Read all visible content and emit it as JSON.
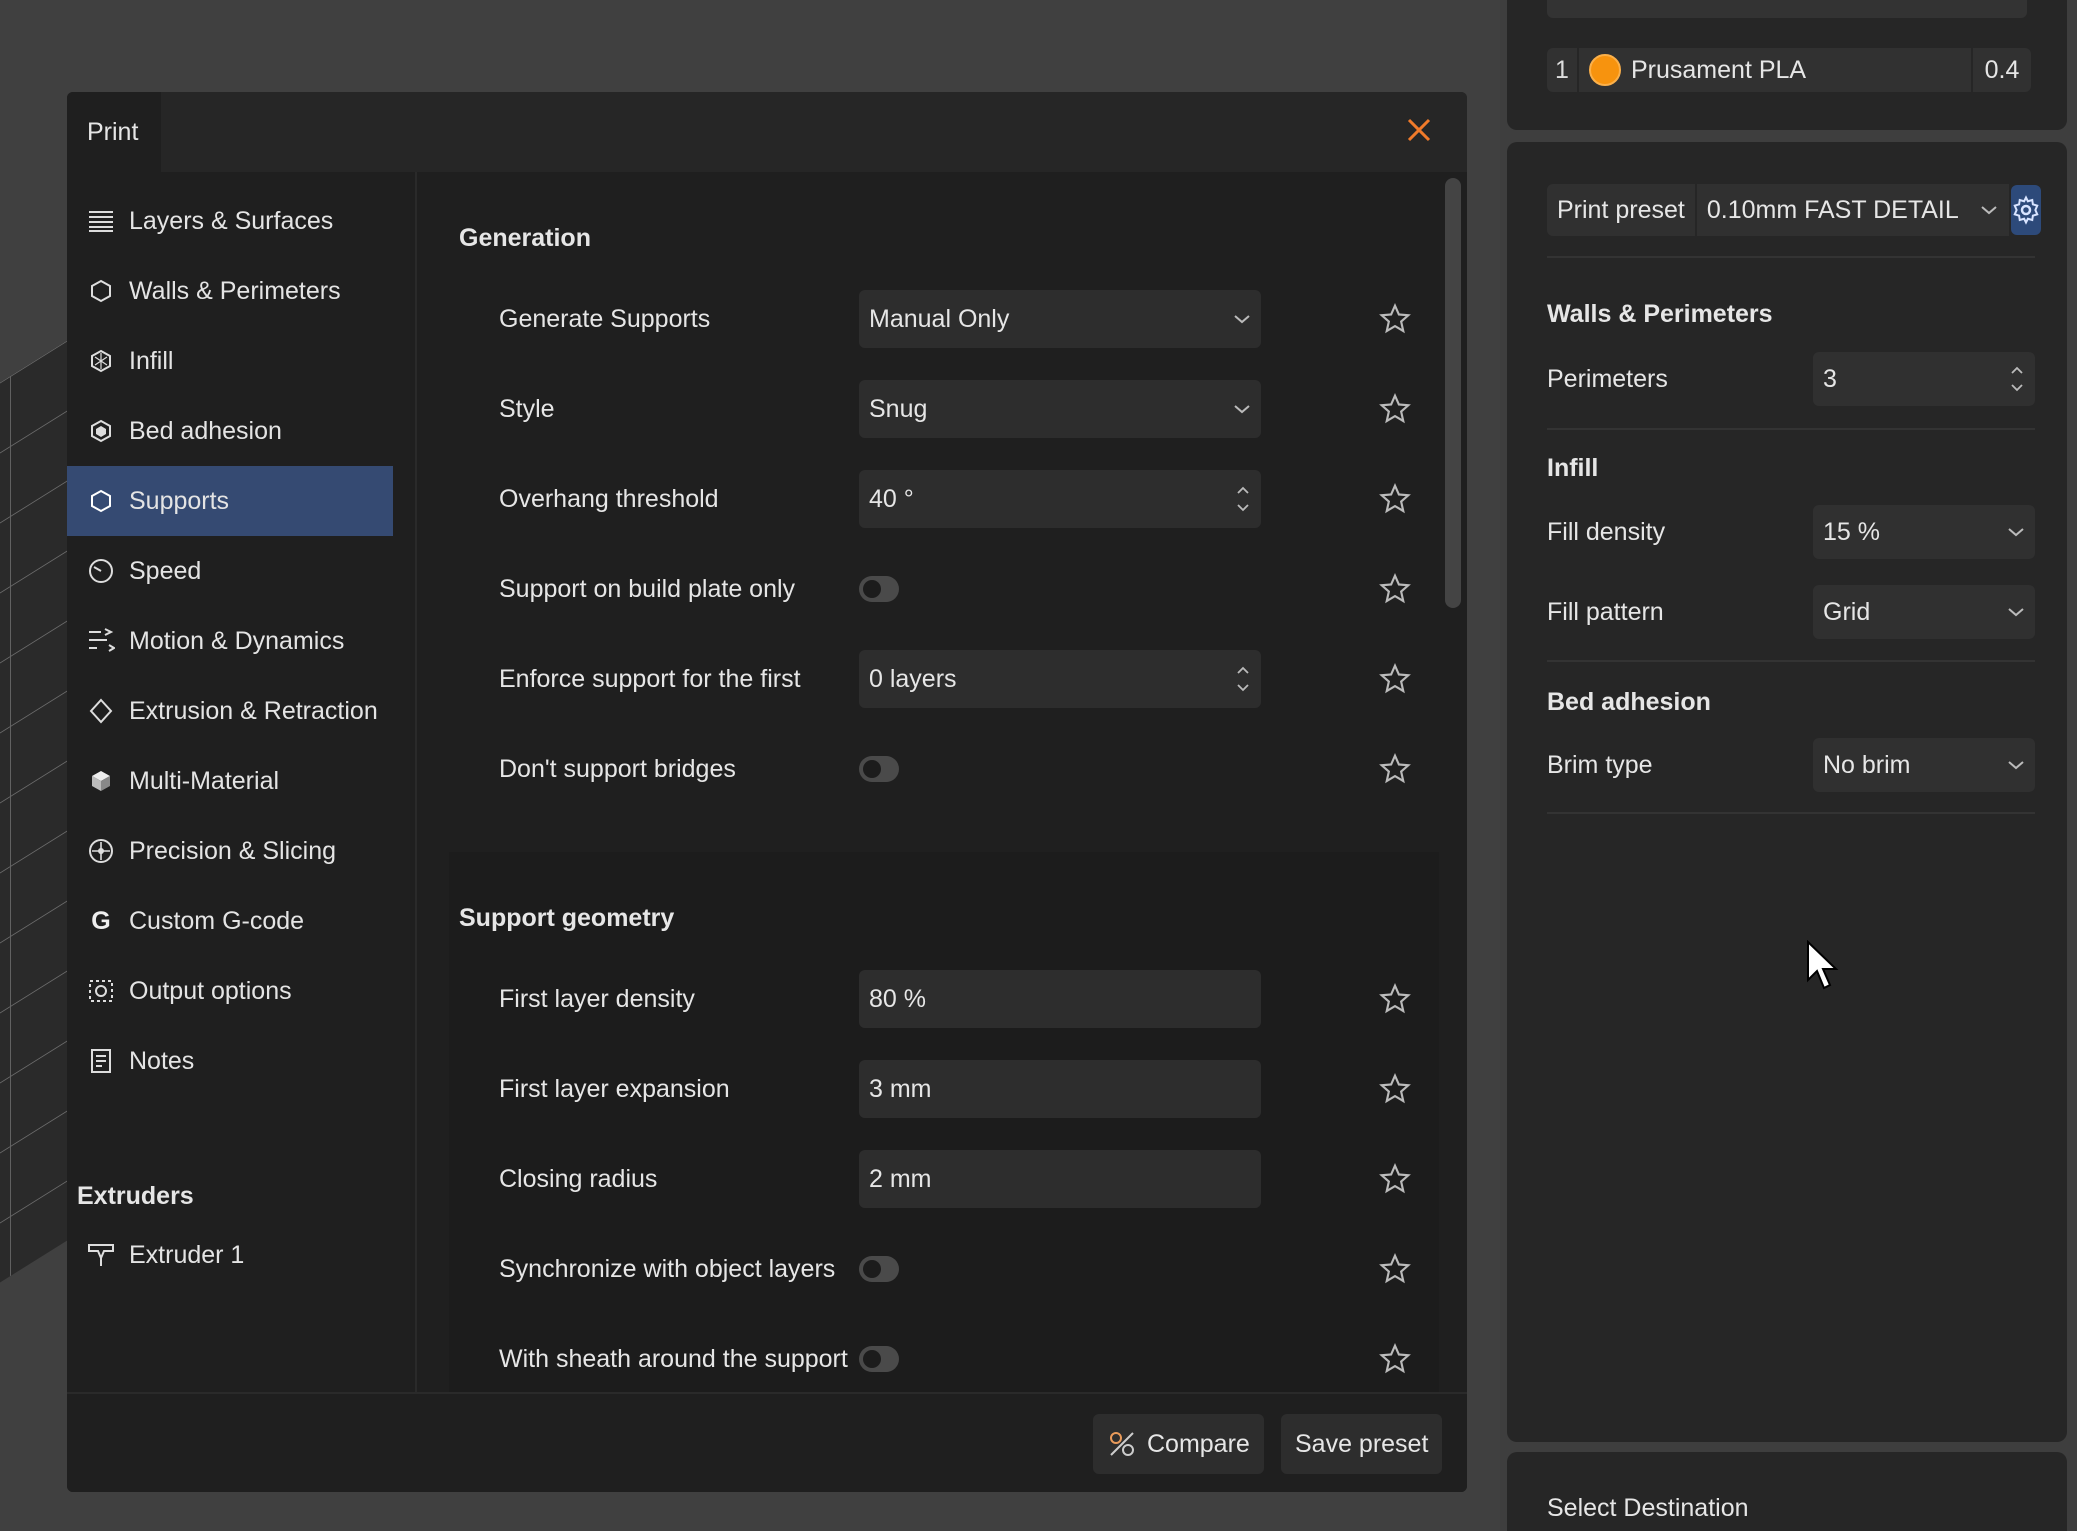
{
  "filament": {
    "index": "1",
    "name": "Prusament PLA",
    "nozzle": "0.4",
    "color": "#f7930e"
  },
  "sidebar": {
    "preset_label": "Print preset",
    "preset_value": "0.10mm FAST DETAIL",
    "walls": {
      "title": "Walls & Perimeters",
      "perimeters_label": "Perimeters",
      "perimeters_value": "3"
    },
    "infill": {
      "title": "Infill",
      "density_label": "Fill density",
      "density_value": "15 %",
      "pattern_label": "Fill pattern",
      "pattern_value": "Grid"
    },
    "bed": {
      "title": "Bed adhesion",
      "brim_label": "Brim type",
      "brim_value": "No brim"
    },
    "destination": "Select Destination"
  },
  "dialog": {
    "tab": "Print",
    "nav": [
      {
        "label": "Layers & Surfaces",
        "icon": "layers-icon"
      },
      {
        "label": "Walls & Perimeters",
        "icon": "walls-icon"
      },
      {
        "label": "Infill",
        "icon": "infill-icon"
      },
      {
        "label": "Bed adhesion",
        "icon": "bed-adhesion-icon"
      },
      {
        "label": "Supports",
        "icon": "supports-icon"
      },
      {
        "label": "Speed",
        "icon": "speed-icon"
      },
      {
        "label": "Motion & Dynamics",
        "icon": "motion-icon"
      },
      {
        "label": "Extrusion & Retraction",
        "icon": "extrusion-icon"
      },
      {
        "label": "Multi-Material",
        "icon": "multi-material-icon"
      },
      {
        "label": "Precision & Slicing",
        "icon": "precision-icon"
      },
      {
        "label": "Custom G-code",
        "icon": "gcode-icon"
      },
      {
        "label": "Output options",
        "icon": "output-icon"
      },
      {
        "label": "Notes",
        "icon": "notes-icon"
      }
    ],
    "extruders_title": "Extruders",
    "extruder_1": "Extruder 1",
    "generation": {
      "title": "Generation",
      "generate_supports": {
        "label": "Generate Supports",
        "value": "Manual Only"
      },
      "style": {
        "label": "Style",
        "value": "Snug"
      },
      "overhang": {
        "label": "Overhang threshold",
        "value": "40 °"
      },
      "build_plate_only": {
        "label": "Support on build plate only"
      },
      "enforce_first": {
        "label": "Enforce support for the first",
        "value": "0 layers"
      },
      "dont_support_bridges": {
        "label": "Don't support bridges"
      }
    },
    "geometry": {
      "title": "Support geometry",
      "first_layer_density": {
        "label": "First layer density",
        "value": "80 %"
      },
      "first_layer_expansion": {
        "label": "First layer expansion",
        "value": "3 mm"
      },
      "closing_radius": {
        "label": "Closing radius",
        "value": "2 mm"
      },
      "sync_layers": {
        "label": "Synchronize with object layers"
      },
      "sheath": {
        "label": "With sheath around the support"
      }
    },
    "compare": "Compare",
    "save_preset": "Save preset"
  }
}
